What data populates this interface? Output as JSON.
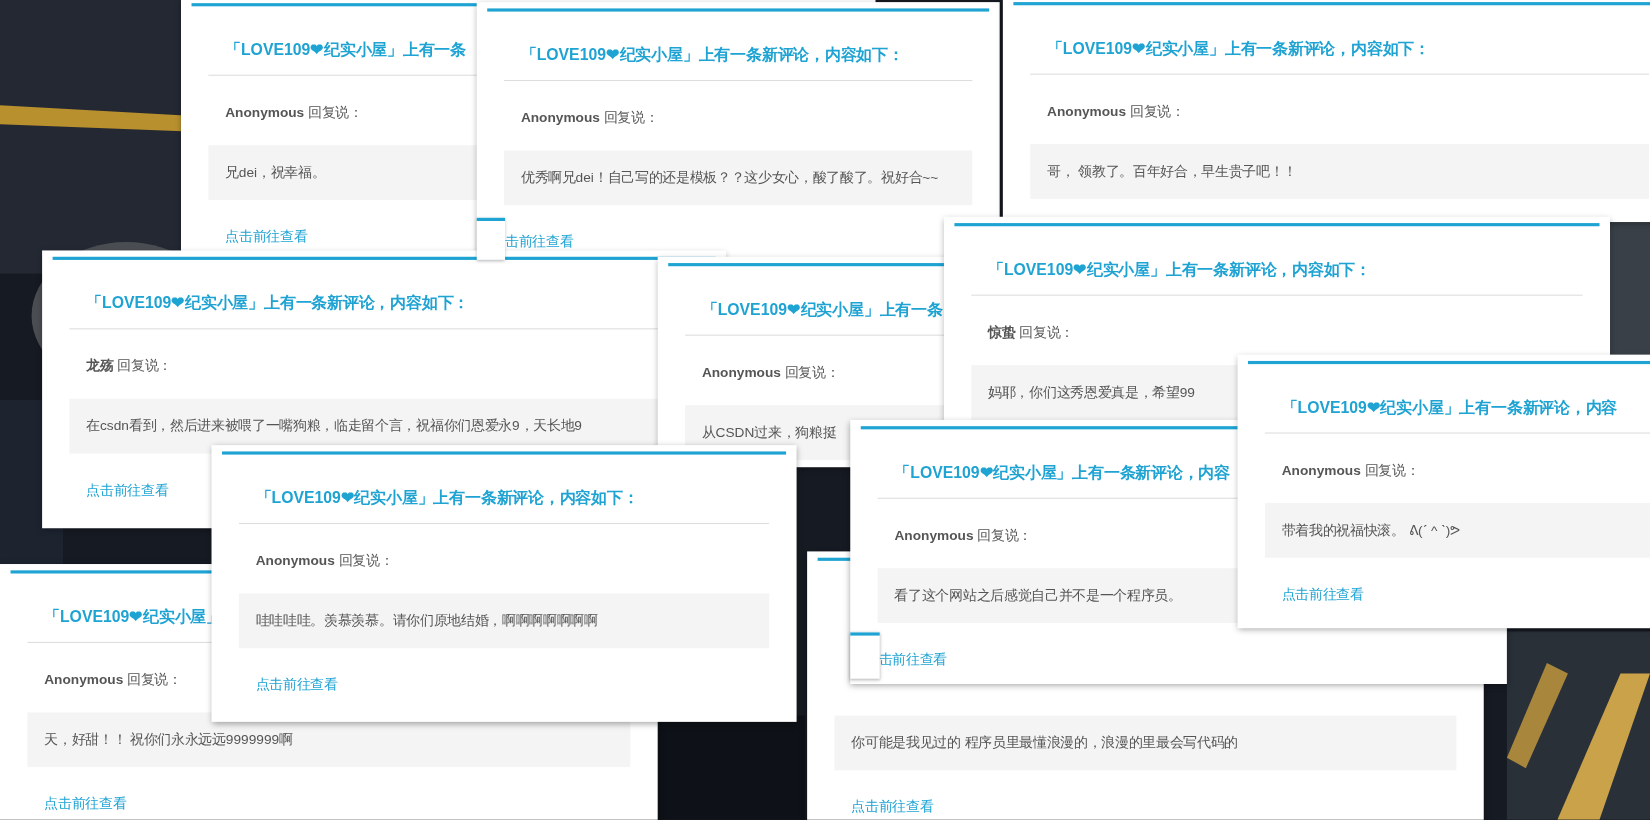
{
  "cards": [
    {
      "title": "「LOVE109❤纪实小屋」上有一条",
      "reply": "**Anonymous** 回复说：",
      "message": "兄dei，祝幸福。",
      "link": "点击前往查看"
    },
    {
      "title": "「LOVE109❤纪实小屋」上有一条新评论，内容如下：",
      "reply": "**Anonymous** 回复说：",
      "message": "优秀啊兄dei！自己写的还是模板？？这少女心，酸了酸了。祝好合~~",
      "link": "击前往查看"
    },
    {
      "title": "「LOVE109❤纪实小屋」上有一条新评论，内容如下：",
      "reply": "**Anonymous** 回复说：",
      "message": "哥， 领教了。百年好合，早生贵子吧！！"
    },
    {
      "title": "「LOVE109❤纪实小屋」上有一条新评论，内容如下：",
      "reply": "**龙殇** 回复说：",
      "message": "在csdn看到，然后进来被喂了一嘴狗粮，临走留个言，祝福你们恩爱永9，天长地9",
      "link": "点击前往查看"
    },
    {
      "title": "「LOVE109❤纪实小屋」上有一条",
      "reply": "**Anonymous** 回复说：",
      "message": "从CSDN过来，狗粮挺"
    },
    {
      "title": "「LOVE109❤纪实小屋」上有一条新评论，内容如下：",
      "reply": "**惊蛰** 回复说：",
      "message": "妈耶，你们这秀恩爱真是，希望99"
    },
    {
      "title": "「LOVE109❤纪实小屋」",
      "reply": "**Anonymous** 回复说：",
      "message": "天，好甜！！ 祝你们永永远远9999999啊",
      "link": "点击前往查看"
    },
    {
      "message": "你可能是我见过的 程序员里最懂浪漫的，浪漫的里最会写代码的",
      "link": "点击前往查看"
    },
    {
      "title": "「LOVE109❤纪实小屋」上有一条新评论，内容如下：",
      "reply": "**Anonymous** 回复说：",
      "message": "哇哇哇哇。羡慕羡慕。请你们原地结婚，啊啊啊啊啊啊啊",
      "link": "点击前往查看"
    },
    {
      "title": "「LOVE109❤纪实小屋」上有一条新评论，内容",
      "reply": "**Anonymous** 回复说：",
      "message": "看了这个网站之后感觉自己并不是一个程序员。",
      "link": "击前往查看"
    },
    {
      "title": "「LOVE109❤纪实小屋」上有一条新评论，内容",
      "reply": "**Anonymous** 回复说：",
      "message": "带着我的祝福快滚。 ᕕ(ˊ ^ ˋ)ᕗ",
      "link": "点击前往查看"
    }
  ]
}
